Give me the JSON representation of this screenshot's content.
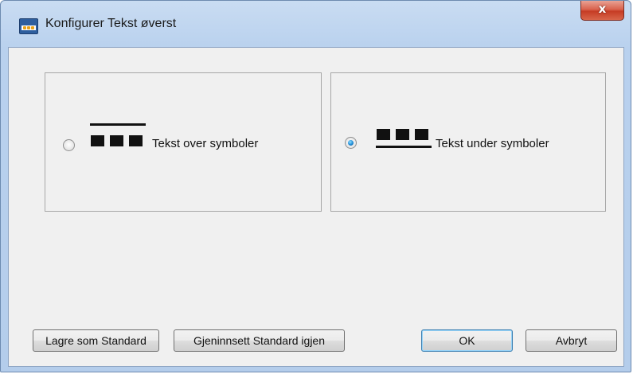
{
  "window": {
    "title": "Konfigurer Tekst øverst",
    "close_label": "x",
    "icon": "toolbar-app-icon"
  },
  "options": [
    {
      "label": "Tekst over symboler",
      "selected": false,
      "icon": "text-above-symbols-icon"
    },
    {
      "label": "Tekst under symboler",
      "selected": true,
      "icon": "text-below-symbols-icon"
    }
  ],
  "buttons": {
    "save_default": "Lagre som Standard",
    "restore_default": "Gjeninnsett Standard igjen",
    "ok": "OK",
    "cancel": "Avbryt"
  }
}
